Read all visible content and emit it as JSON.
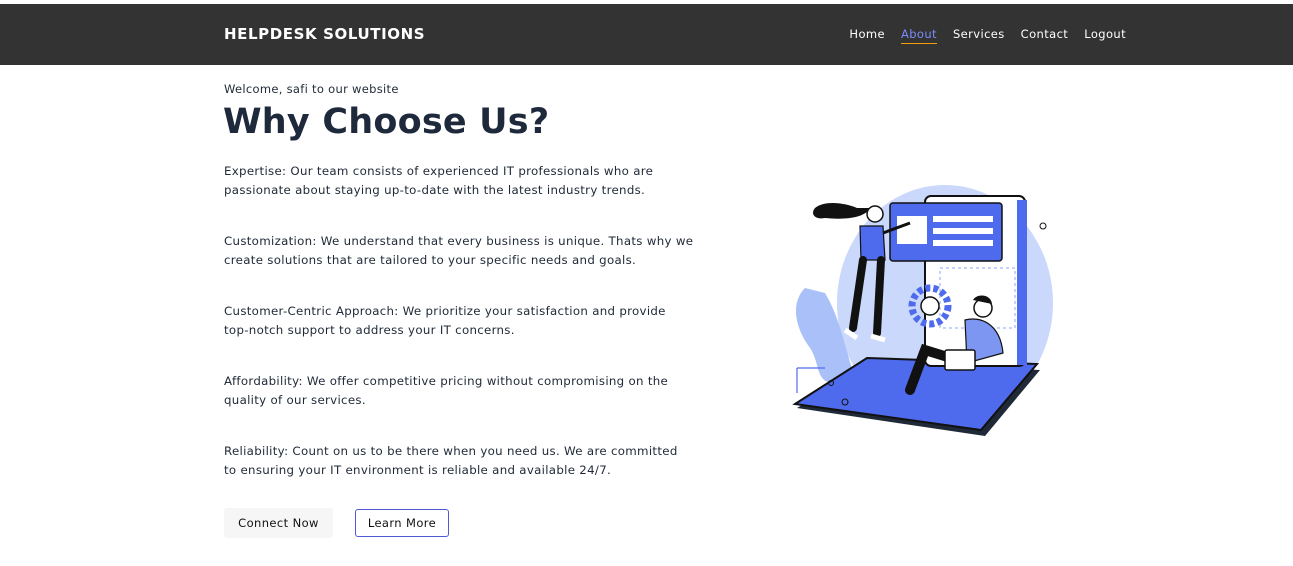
{
  "navbar": {
    "brand": "HELPDESK SOLUTIONS",
    "links": [
      {
        "label": "Home",
        "active": false
      },
      {
        "label": "About",
        "active": true
      },
      {
        "label": "Services",
        "active": false
      },
      {
        "label": "Contact",
        "active": false
      },
      {
        "label": "Logout",
        "active": false
      }
    ]
  },
  "hero": {
    "welcome": "Welcome, safi to our website",
    "title": "Why Choose Us?",
    "points": [
      "Expertise: Our team consists of experienced IT professionals who are passionate about staying up-to-date with the latest industry trends.",
      "Customization: We understand that every business is unique. Thats why we create solutions that are tailored to your specific needs and goals.",
      "Customer-Centric Approach: We prioritize your satisfaction and provide top-notch support to address your IT concerns.",
      "Affordability: We offer competitive pricing without compromising on the quality of our services.",
      "Reliability: Count on us to be there when you need us. We are committed to ensuring your IT environment is reliable and available 24/7."
    ],
    "buttons": {
      "primary": "Connect Now",
      "secondary": "Learn More"
    }
  },
  "colors": {
    "navbar_bg": "#333333",
    "accent": "#4f6bed",
    "active_link": "#7c8cf8",
    "active_underline": "#f59e0b",
    "light_blue": "#c7d7fb"
  }
}
